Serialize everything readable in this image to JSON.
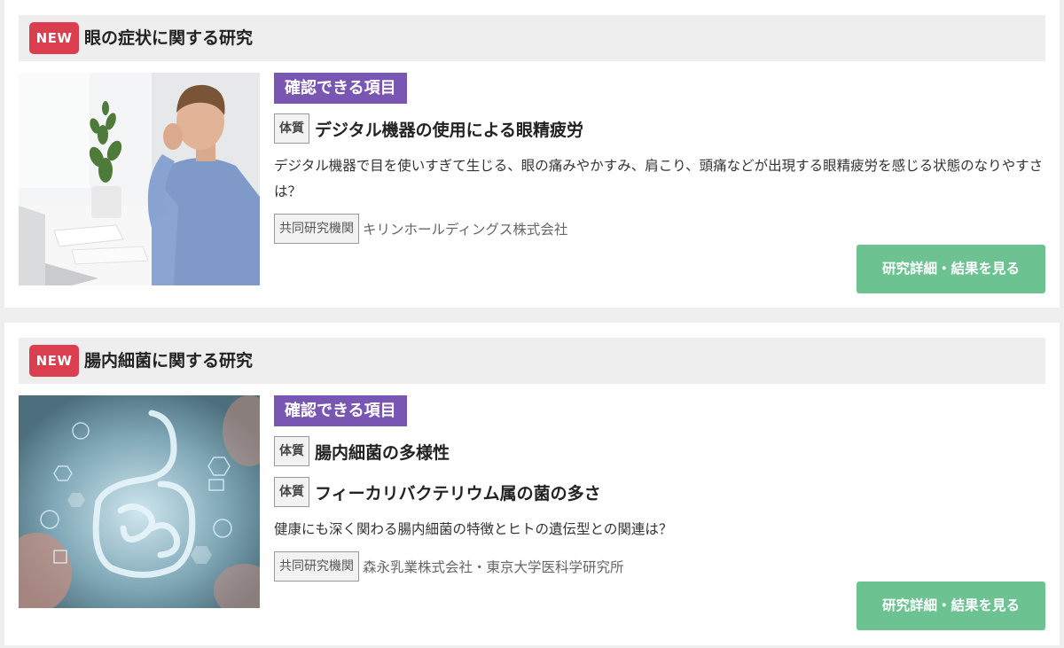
{
  "studies": [
    {
      "badge": "NEW",
      "title": "眼の症状に関する研究",
      "image_alt": "man-rubbing-eyes-at-laptop",
      "items_label": "確認できる項目",
      "items": [
        {
          "tag": "体質",
          "text": "デジタル機器の使用による眼精疲労"
        }
      ],
      "description": "デジタル機器で目を使いすぎて生じる、眼の痛みやかすみ、肩こり、頭痛などが出現する眼精疲労を感じる状態のなりやすさは？",
      "org_label": "共同研究機関",
      "org_name": "キリンホールディングス株式会社",
      "button_label": "研究詳細・結果を見る"
    },
    {
      "badge": "NEW",
      "title": "腸内細菌に関する研究",
      "image_alt": "digital-intestine-illustration",
      "items_label": "確認できる項目",
      "items": [
        {
          "tag": "体質",
          "text": "腸内細菌の多様性"
        },
        {
          "tag": "体質",
          "text": "フィーカリバクテリウム属の菌の多さ"
        }
      ],
      "description": "健康にも深く関わる腸内細菌の特徴とヒトの遺伝型との関連は？",
      "org_label": "共同研究機関",
      "org_name": "森永乳業株式会社・東京大学医科学研究所",
      "button_label": "研究詳細・結果を見る"
    }
  ],
  "colors": {
    "new_badge": "#db3f4f",
    "items_label_bg": "#7a56b3",
    "button_bg": "#6cc391",
    "header_bg": "#eeeeee",
    "page_bg": "#efefef"
  }
}
